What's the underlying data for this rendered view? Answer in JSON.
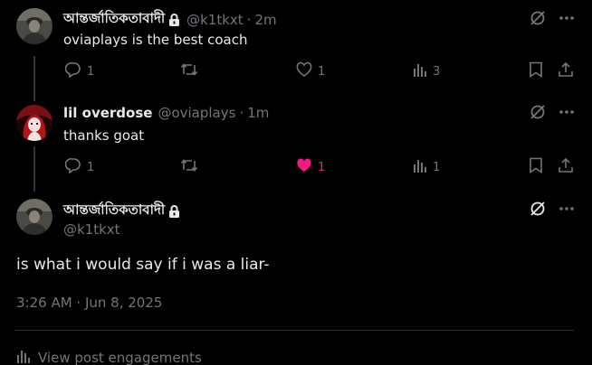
{
  "tweets": [
    {
      "display_name": "আন্তর্জাতিকতাবাদী",
      "handle": "@k1tkxt",
      "separator": "·",
      "time": "2m",
      "text": "oviaplays is the best coach",
      "replies": "1",
      "likes": "1",
      "views": "3"
    },
    {
      "display_name": "lil overdose",
      "handle": "@oviaplays",
      "separator": "·",
      "time": "1m",
      "text": "thanks goat",
      "replies": "1",
      "likes": "1",
      "views": "1",
      "liked_color": "#f91880"
    }
  ],
  "main_tweet": {
    "display_name": "আন্তর্জাতিকতাবাদী",
    "handle": "@k1tkxt",
    "text": "is what i would say if i was a liar-",
    "timestamp": "3:26 AM · Jun 8, 2025"
  },
  "engagements_link": "View post engagements",
  "icons": [
    "reply-icon",
    "retweet-icon",
    "like-icon",
    "views-icon",
    "bookmark-icon",
    "share-icon",
    "grok-icon",
    "more-icon",
    "lock-icon"
  ]
}
